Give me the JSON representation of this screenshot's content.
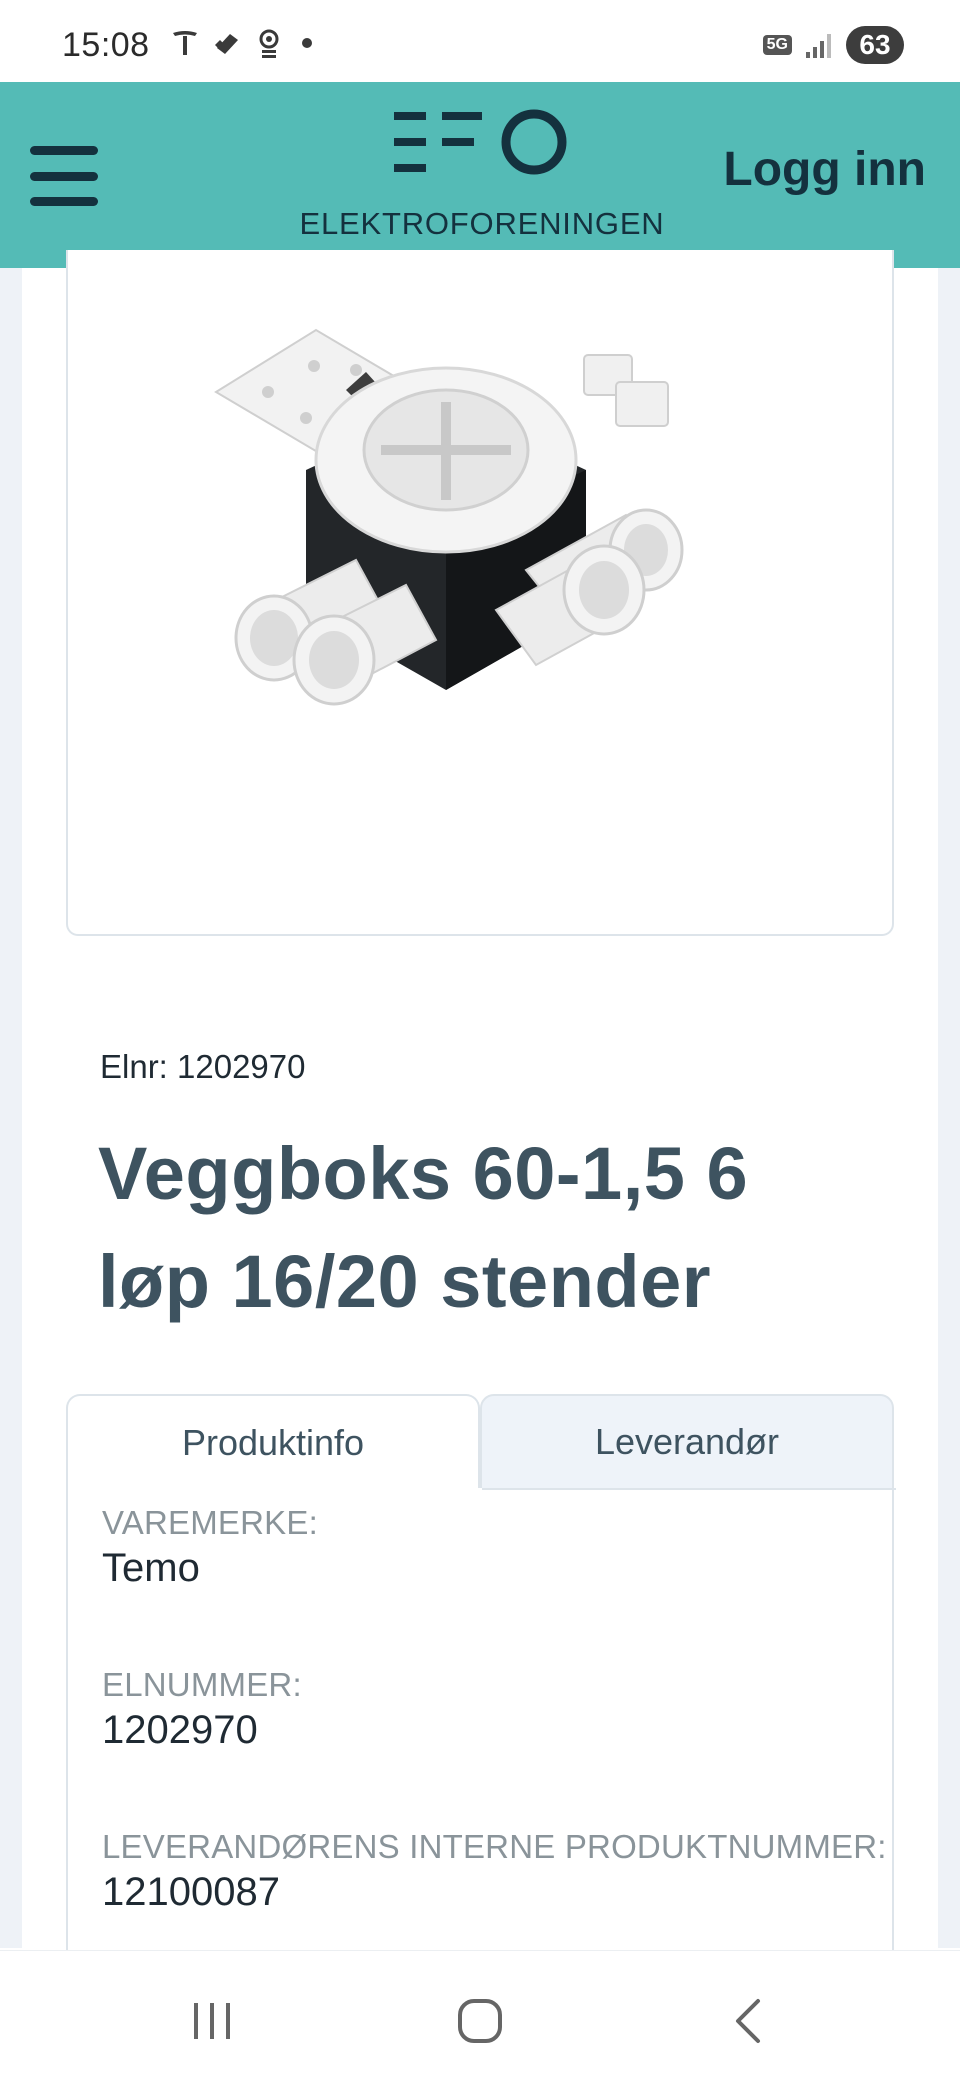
{
  "status_bar": {
    "time": "15:08",
    "network": "5G",
    "battery": "63",
    "icons": [
      "tesla-icon",
      "cloud-icon",
      "location-pin-icon",
      "notification-dot-icon",
      "signal-icon"
    ]
  },
  "header": {
    "brand": "ELEKTROFORENINGEN",
    "login_label": "Logg inn",
    "menu_icon": "hamburger-menu-icon",
    "colors": {
      "background": "#54bbb6",
      "foreground": "#14313e"
    }
  },
  "product": {
    "image_icon": "product-image",
    "elnr": "Elnr: 1202970",
    "title": "Veggboks 60-1,5 6 løp 16/20 stender"
  },
  "tabs": [
    {
      "label": "Produktinfo",
      "active": true
    },
    {
      "label": "Leverandør",
      "active": false
    }
  ],
  "fields": [
    {
      "label": "VAREMERKE:",
      "value": "Temo"
    },
    {
      "label": "ELNUMMER:",
      "value": "1202970"
    },
    {
      "label": "LEVERANDØRENS INTERNE PRODUKTNUMMER:",
      "value": "12100087"
    }
  ],
  "nav_bar": {
    "icons": [
      "recent-apps-icon",
      "home-icon",
      "back-icon"
    ]
  }
}
